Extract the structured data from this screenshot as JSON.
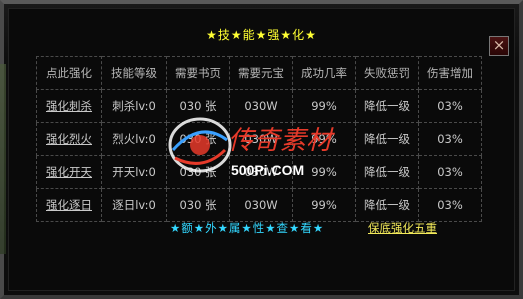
{
  "title": "★技★能★强★化★",
  "close_label": "×",
  "table": {
    "headers": [
      "点此强化",
      "技能等级",
      "需要书页",
      "需要元宝",
      "成功几率",
      "失败惩罚",
      "伤害增加"
    ],
    "rows": [
      [
        "强化刺杀",
        "刺杀lv:0",
        "030 张",
        "030W",
        "99%",
        "降低一级",
        "03%"
      ],
      [
        "强化烈火",
        "烈火lv:0",
        "030 张",
        "030W",
        "99%",
        "降低一级",
        "03%"
      ],
      [
        "强化开天",
        "开天lv:0",
        "030 张",
        "030W",
        "99%",
        "降低一级",
        "03%"
      ],
      [
        "强化逐日",
        "逐日lv:0",
        "030 张",
        "030W",
        "99%",
        "降低一级",
        "03%"
      ]
    ]
  },
  "extra_attributes_label": "★额★外★属★性★查★看★",
  "guarantee_link": "保底强化五重",
  "watermark": {
    "logo_text": "传奇素材",
    "site": "500Pi.COM",
    "icon": "500pi-swirl-logo"
  },
  "colors": {
    "title": "#ffff33",
    "link": "#f3ea5a",
    "cyan": "#33d7ff",
    "text": "#c9c9c9"
  }
}
